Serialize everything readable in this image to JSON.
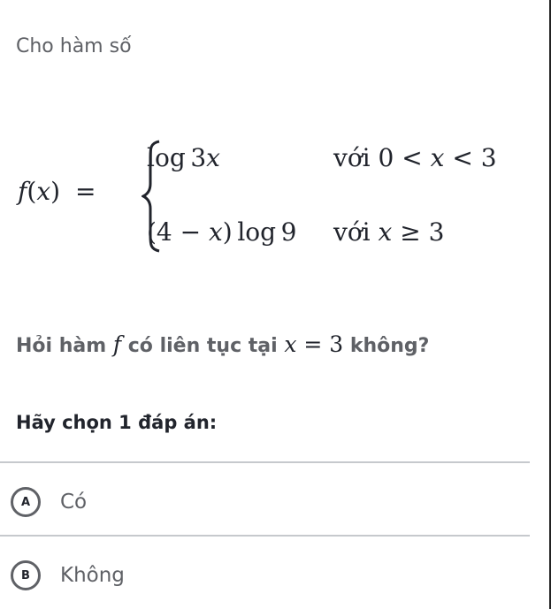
{
  "intro": "Cho hàm số",
  "formula": {
    "lhs": {
      "f": "f",
      "open": "(",
      "x": "x",
      "close": ")",
      "eq": "="
    },
    "cases": [
      {
        "expr": "log 3x",
        "expr_func": "log",
        "expr_num": "3",
        "expr_var": "x",
        "cond_word": "với",
        "cond": "0 < x < 3",
        "cond_left": "0",
        "cond_op1": "<",
        "cond_var": "x",
        "cond_op2": "<",
        "cond_right": "3"
      },
      {
        "expr": "(4 − x) log 9",
        "expr_paren_open": "(4 − ",
        "expr_var": "x",
        "expr_paren_close": ")",
        "expr_func": "log",
        "expr_num": "9",
        "cond_word": "với",
        "cond": "x ≥ 3",
        "cond_var": "x",
        "cond_op": "≥",
        "cond_right": "3"
      }
    ]
  },
  "question": {
    "part1": "Hỏi hàm ",
    "f": "f",
    "part2": " có liên tục tại ",
    "eq_var": "x",
    "eq_rest": " = 3",
    "part3": " không?"
  },
  "prompt": "Hãy chọn 1 đáp án:",
  "choices": [
    {
      "letter": "A",
      "label": "Có"
    },
    {
      "letter": "B",
      "label": "Không"
    }
  ],
  "colors": {
    "text_muted": "#5f6166",
    "text_dark": "#21242c",
    "divider": "#c6c9cd"
  }
}
